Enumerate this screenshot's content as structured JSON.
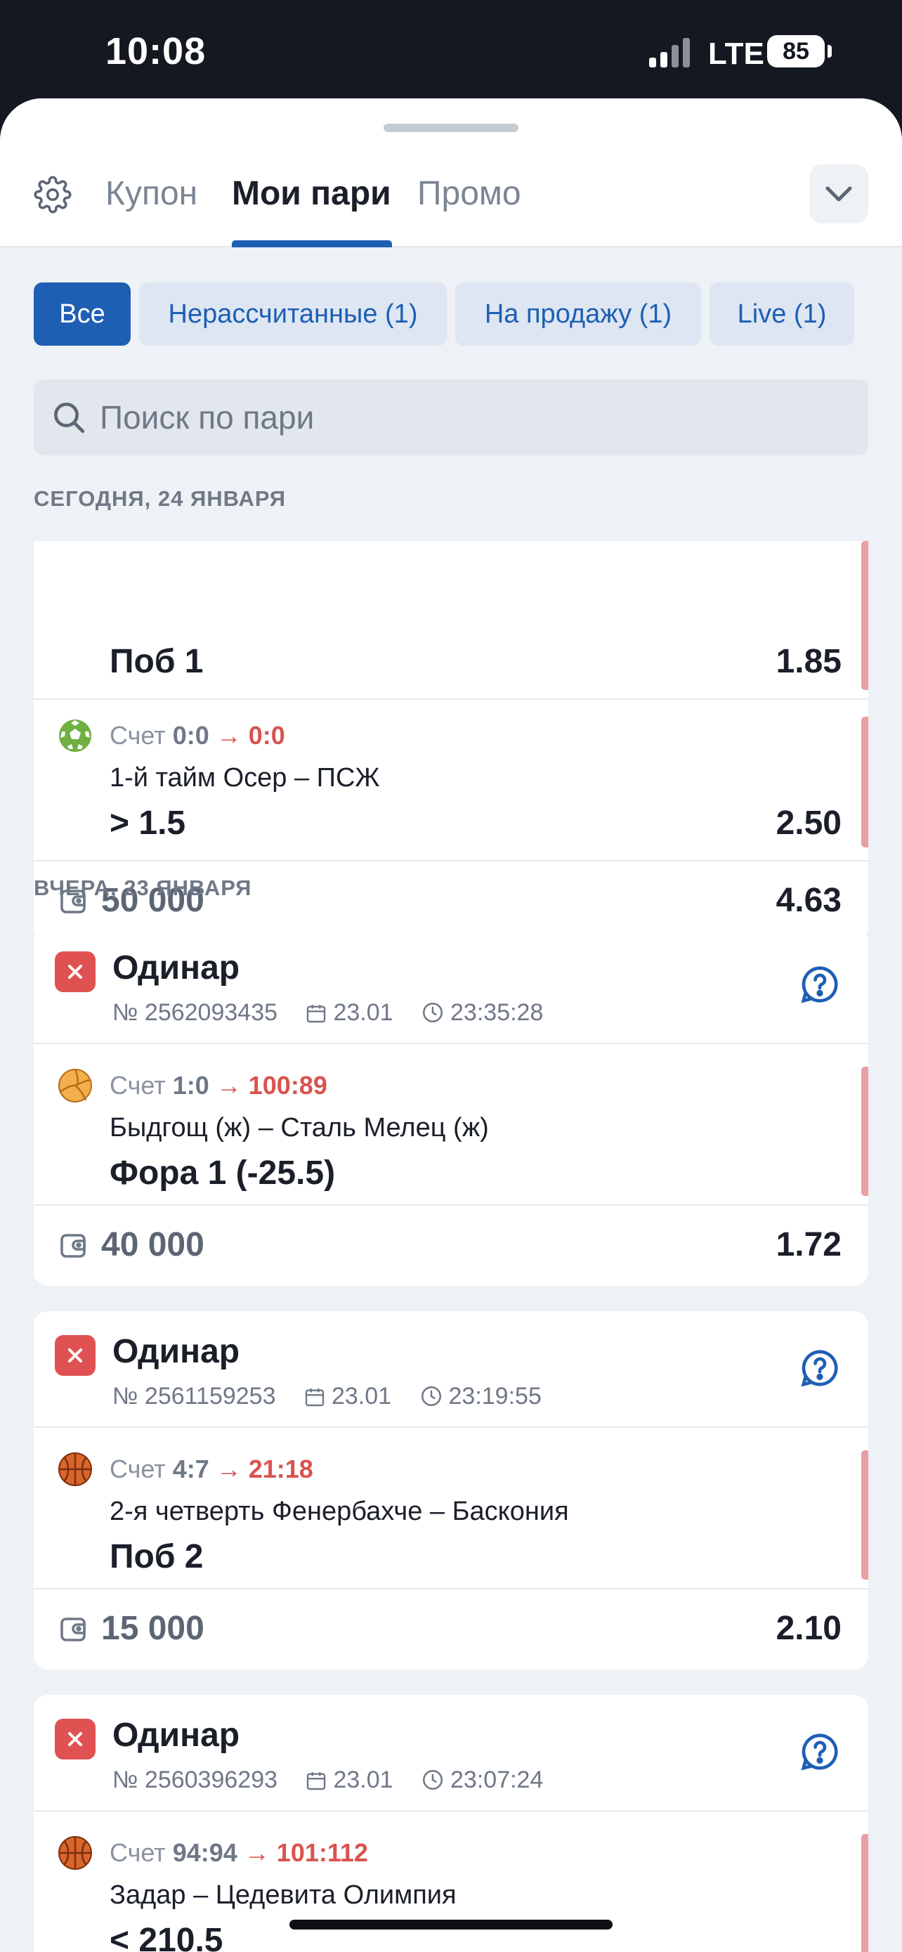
{
  "status_bar": {
    "time": "10:08",
    "network": "LTE",
    "battery": "85"
  },
  "header": {
    "tabs": [
      "Купон",
      "Мои пари",
      "Промо"
    ],
    "active_tab": "Мои пари"
  },
  "filters": [
    "Все",
    "Нерассчитанные (1)",
    "На продажу (1)",
    "Live (1)"
  ],
  "active_filter": "Все",
  "search": {
    "placeholder": "Поиск по пари",
    "value": ""
  },
  "sections": [
    {
      "label": "СЕГОДНЯ, 24 ЯНВАРЯ",
      "card": {
        "selections": [
          {
            "bet": "Поб 1",
            "odds": "1.85"
          },
          {
            "sport_icon": "soccer-ball-icon",
            "score_label": "Счет",
            "score_from": "0:0",
            "score_to": "0:0",
            "match": "1-й тайм Осер – ПСЖ",
            "bet": "> 1.5",
            "odds": "2.50"
          }
        ],
        "stake": "50 000",
        "total_odds": "4.63"
      }
    },
    {
      "label": "ВЧЕРА, 23 ЯНВАРЯ",
      "cards": [
        {
          "status": "lost",
          "type": "Одинар",
          "number": "№ 2562093435",
          "date": "23.01",
          "time": "23:35:28",
          "selection": {
            "sport_icon": "volleyball-icon",
            "score_label": "Счет",
            "score_from": "1:0",
            "score_to": "100:89",
            "match": "Быдгощ (ж) – Сталь Мелец (ж)",
            "bet": "Фора 1 (-25.5)"
          },
          "stake": "40 000",
          "total_odds": "1.72"
        },
        {
          "status": "lost",
          "type": "Одинар",
          "number": "№ 2561159253",
          "date": "23.01",
          "time": "23:19:55",
          "selection": {
            "sport_icon": "basketball-icon",
            "score_label": "Счет",
            "score_from": "4:7",
            "score_to": "21:18",
            "match": "2-я четверть Фенербахче – Баскония",
            "bet": "Поб 2"
          },
          "stake": "15 000",
          "total_odds": "2.10"
        },
        {
          "status": "lost",
          "type": "Одинар",
          "number": "№ 2560396293",
          "date": "23.01",
          "time": "23:07:24",
          "selection": {
            "sport_icon": "basketball-icon",
            "score_label": "Счет",
            "score_from": "94:94",
            "score_to": "101:112",
            "match": "Задар – Цедевита Олимпия",
            "bet": "< 210.5"
          }
        }
      ]
    }
  ],
  "colors": {
    "accent": "#1e5fb3",
    "loss": "#e05252",
    "live_score": "#d9534f",
    "background": "#eef1f5"
  }
}
